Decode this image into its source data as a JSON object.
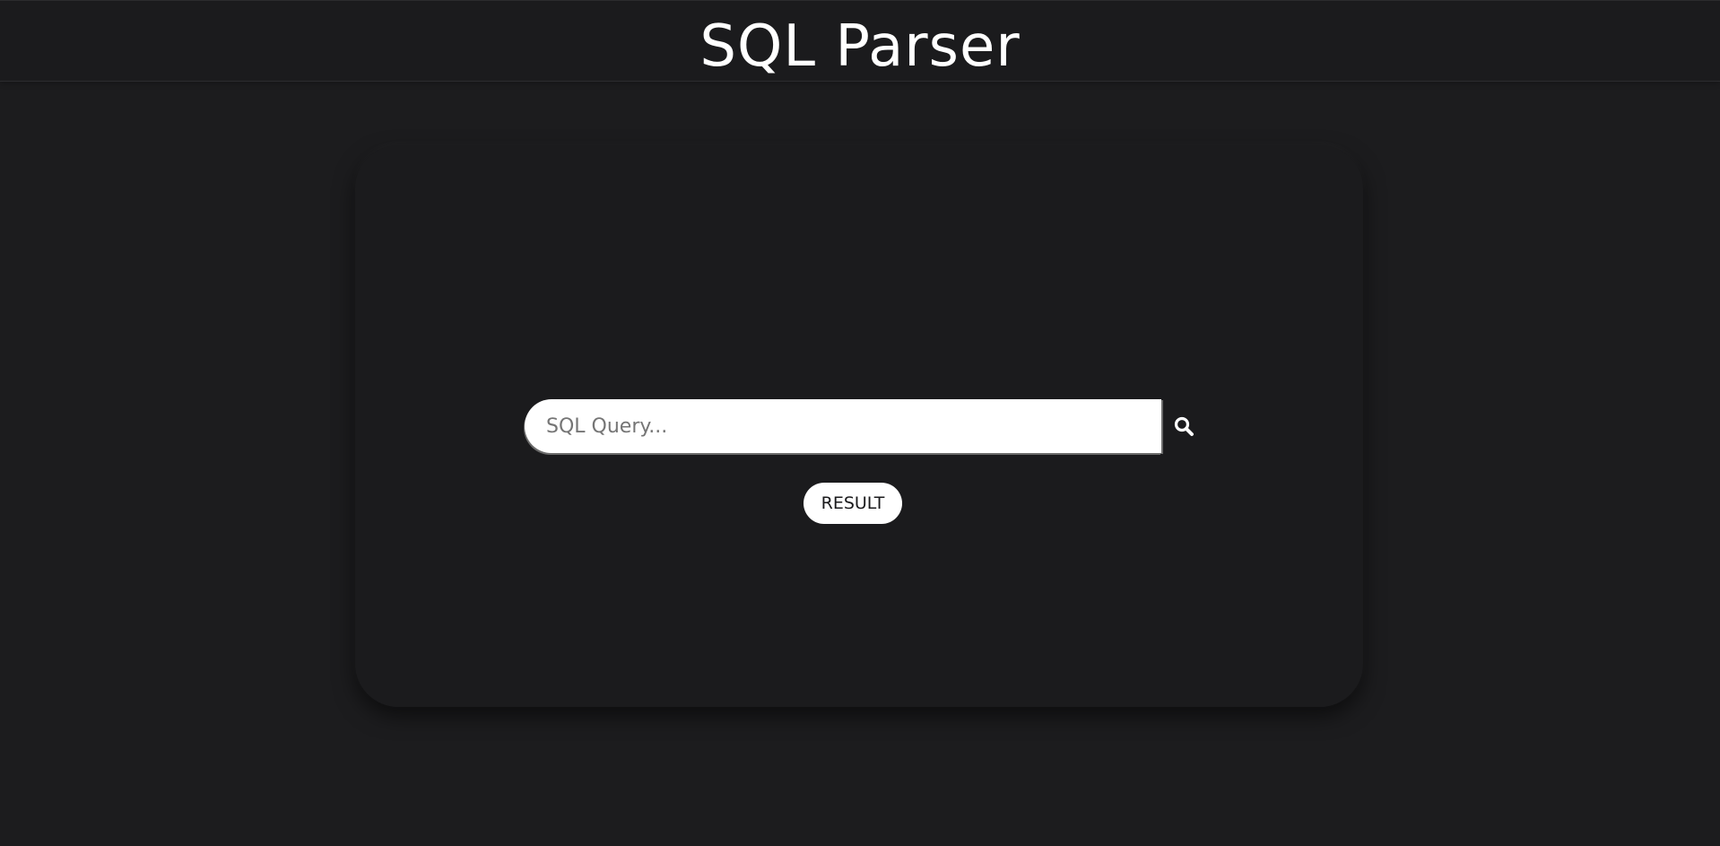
{
  "header": {
    "title": "SQL Parser"
  },
  "search": {
    "placeholder": "SQL Query...",
    "value": "",
    "icon": "search-icon"
  },
  "actions": {
    "result_label": "RESULT"
  },
  "colors": {
    "background": "#1c1c1e",
    "card": "#1b1b1d",
    "text": "#ffffff",
    "input_background": "#ffffff"
  }
}
